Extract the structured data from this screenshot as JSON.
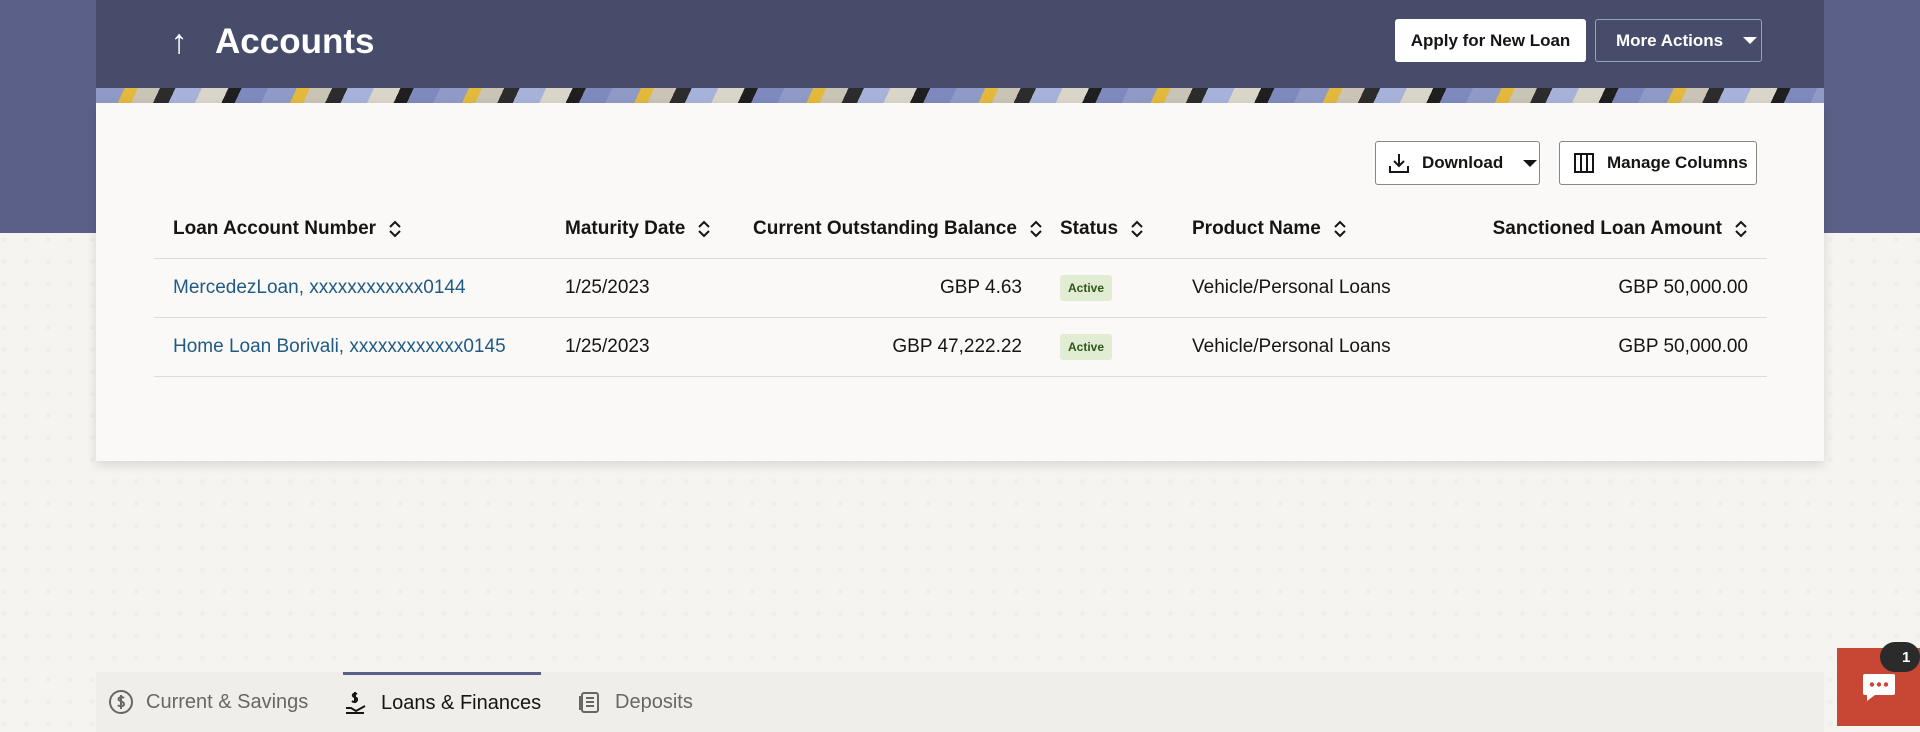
{
  "header": {
    "title": "Accounts",
    "back_icon": "arrow-up-icon",
    "apply_button": "Apply for New Loan",
    "more_actions_button": "More Actions"
  },
  "toolbar": {
    "download_label": "Download",
    "manage_columns_label": "Manage Columns"
  },
  "table": {
    "columns": [
      "Loan Account Number",
      "Maturity Date",
      "Current Outstanding Balance",
      "Status",
      "Product Name",
      "Sanctioned Loan Amount"
    ],
    "rows": [
      {
        "account": "MercedezLoan, xxxxxxxxxxxx0144",
        "maturity_date": "1/25/2023",
        "balance": "GBP 4.63",
        "status": "Active",
        "product": "Vehicle/Personal Loans",
        "sanctioned": "GBP 50,000.00"
      },
      {
        "account": "Home Loan Borivali, xxxxxxxxxxxx0145",
        "maturity_date": "1/25/2023",
        "balance": "GBP 47,222.22",
        "status": "Active",
        "product": "Vehicle/Personal Loans",
        "sanctioned": "GBP 50,000.00"
      }
    ]
  },
  "tabs": [
    {
      "label": "Current & Savings",
      "icon": "dollar-circle-icon",
      "active": false
    },
    {
      "label": "Loans & Finances",
      "icon": "hand-dollar-icon",
      "active": true
    },
    {
      "label": "Deposits",
      "icon": "deposit-stack-icon",
      "active": false
    }
  ],
  "chat": {
    "badge_count": "1",
    "icon": "chat-icon"
  },
  "colors": {
    "header_bg": "#474c6b",
    "band_bg": "#5a6088",
    "link": "#1f5a84",
    "badge_bg": "#e0edd3",
    "chat_bg": "#c74634"
  }
}
